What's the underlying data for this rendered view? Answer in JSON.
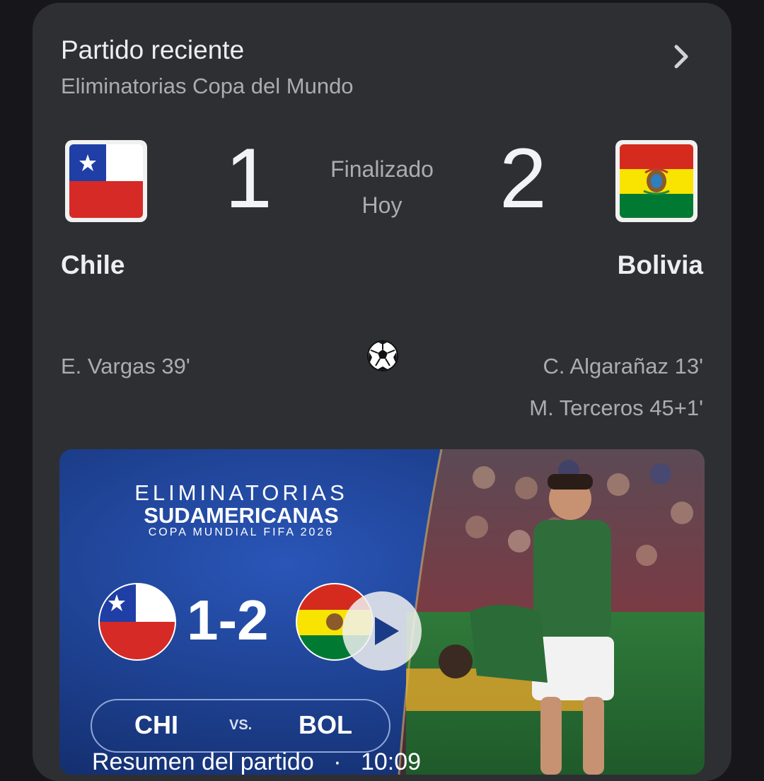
{
  "card": {
    "title": "Partido reciente",
    "subtitle": "Eliminatorias Copa del Mundo",
    "chevron_icon": "chevron-right-icon"
  },
  "match": {
    "home": {
      "name": "Chile",
      "score": "1",
      "flag_icon": "chile-flag-icon"
    },
    "away": {
      "name": "Bolivia",
      "score": "2",
      "flag_icon": "bolivia-flag-icon"
    },
    "status": "Finalizado",
    "date": "Hoy",
    "goal_icon": "soccer-ball-icon",
    "home_scorers": [
      "E. Vargas 39'"
    ],
    "away_scorers": [
      "C. Algarañaz 13'",
      "M. Terceros 45+1'"
    ]
  },
  "video": {
    "line1": "ELIMINATORIAS",
    "line2": "SUDAMERICANAS",
    "line3": "COPA MUNDIAL FIFA 2026",
    "score": "1-2",
    "home_code": "CHI",
    "vs": "VS.",
    "away_code": "BOL",
    "caption": "Resumen del partido",
    "separator": "·",
    "duration": "10:09",
    "play_icon": "play-icon"
  },
  "colors": {
    "background": "#17171b",
    "card": "#2e2f33",
    "text_primary": "#eceef1",
    "text_secondary": "#a9adb2",
    "video_blue": "#1a3b87"
  }
}
